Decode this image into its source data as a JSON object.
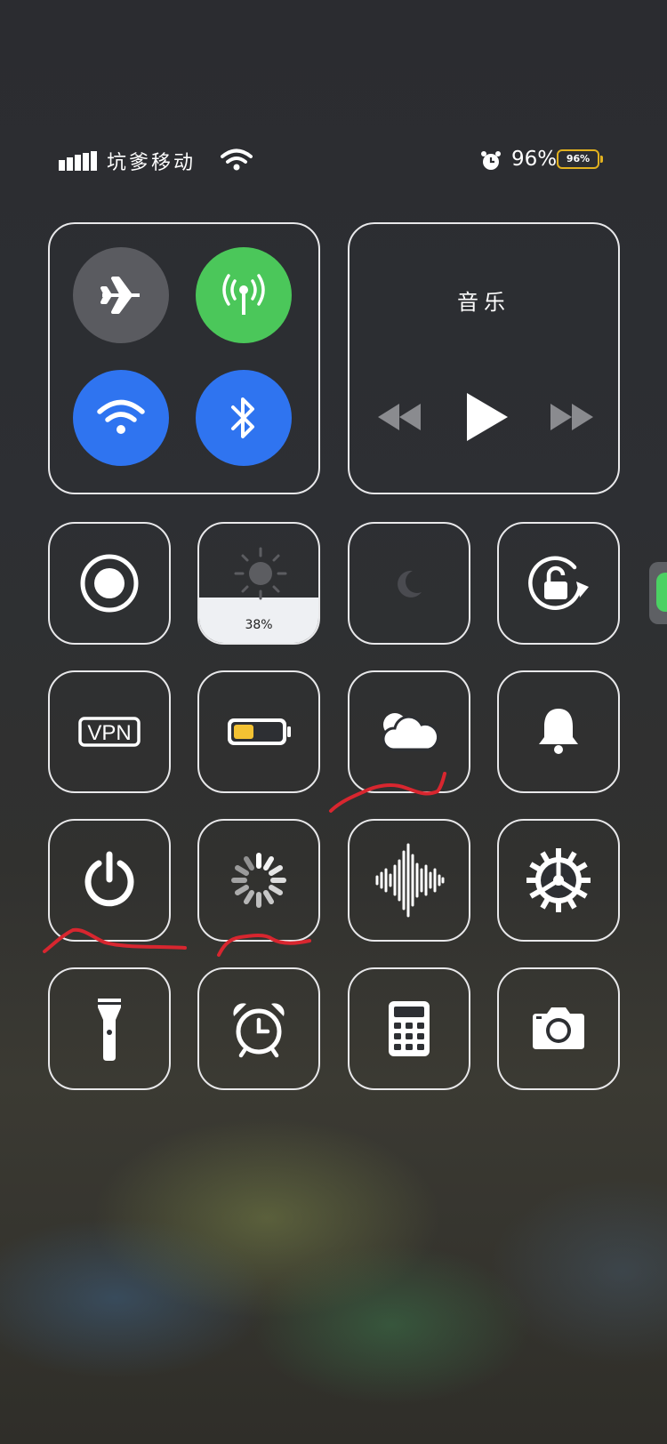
{
  "status_bar": {
    "carrier": "坑爹移动",
    "battery_percent_text": "96%",
    "battery_icon_text": "96%",
    "battery_color": "#e2b11f",
    "icons": [
      "signal-icon",
      "wifi-icon",
      "alarm-icon",
      "battery-icon"
    ]
  },
  "connectivity": {
    "airplane": {
      "icon": "airplane-icon",
      "active": false,
      "color": "#5a5b60"
    },
    "cellular": {
      "icon": "cellular-antenna-icon",
      "active": true,
      "color": "#4bc75a"
    },
    "wifi": {
      "icon": "wifi-icon",
      "active": true,
      "color": "#2f74f0"
    },
    "bluetooth": {
      "icon": "bluetooth-icon",
      "active": true,
      "color": "#2f74f0"
    }
  },
  "music": {
    "title": "音乐",
    "controls": [
      "rewind-icon",
      "play-icon",
      "fast-forward-icon"
    ]
  },
  "brightness": {
    "value_text": "38%",
    "level": 0.38
  },
  "tiles": [
    {
      "name": "screen-record",
      "icon": "record-icon"
    },
    {
      "name": "brightness-slider",
      "icon": "sun-icon"
    },
    {
      "name": "do-not-disturb",
      "icon": "moon-icon",
      "active": false
    },
    {
      "name": "rotation-lock",
      "icon": "rotation-lock-icon"
    },
    {
      "name": "vpn",
      "icon": "vpn-icon",
      "label": "VPN"
    },
    {
      "name": "low-power-mode",
      "icon": "battery-low-icon"
    },
    {
      "name": "weather",
      "icon": "weather-cloud-icon"
    },
    {
      "name": "ring-silent",
      "icon": "bell-icon"
    },
    {
      "name": "power",
      "icon": "power-icon"
    },
    {
      "name": "loading",
      "icon": "spinner-icon"
    },
    {
      "name": "voice-memo",
      "icon": "sound-wave-icon"
    },
    {
      "name": "settings",
      "icon": "gear-icon"
    },
    {
      "name": "flashlight",
      "icon": "flashlight-icon"
    },
    {
      "name": "clock-alarm",
      "icon": "alarm-clock-icon"
    },
    {
      "name": "calculator",
      "icon": "calculator-icon"
    },
    {
      "name": "camera",
      "icon": "camera-icon"
    }
  ],
  "annotations": {
    "color": "#d8262f"
  }
}
